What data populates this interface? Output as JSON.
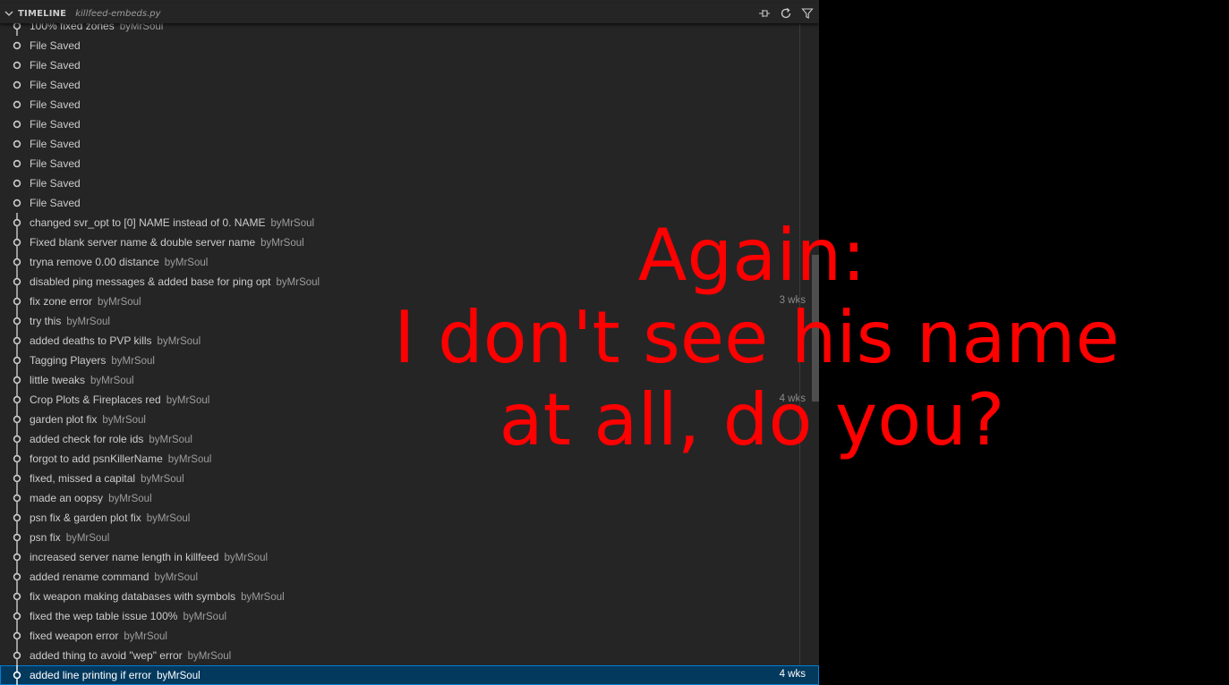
{
  "header": {
    "title": "TIMELINE",
    "file": "killfeed-embeds.py",
    "actions": [
      "pin-icon",
      "refresh-icon",
      "filter-icon"
    ]
  },
  "entries": [
    {
      "label": "100% fixed zones",
      "author": "byMrSoul",
      "time": "",
      "kind": "commit"
    },
    {
      "label": "File Saved",
      "author": "",
      "time": "",
      "kind": "save"
    },
    {
      "label": "File Saved",
      "author": "",
      "time": "",
      "kind": "save"
    },
    {
      "label": "File Saved",
      "author": "",
      "time": "",
      "kind": "save"
    },
    {
      "label": "File Saved",
      "author": "",
      "time": "",
      "kind": "save"
    },
    {
      "label": "File Saved",
      "author": "",
      "time": "",
      "kind": "save"
    },
    {
      "label": "File Saved",
      "author": "",
      "time": "",
      "kind": "save"
    },
    {
      "label": "File Saved",
      "author": "",
      "time": "",
      "kind": "save"
    },
    {
      "label": "File Saved",
      "author": "",
      "time": "",
      "kind": "save"
    },
    {
      "label": "File Saved",
      "author": "",
      "time": "",
      "kind": "save"
    },
    {
      "label": "changed svr_opt to [0] NAME instead of 0. NAME",
      "author": "byMrSoul",
      "time": "",
      "kind": "commit"
    },
    {
      "label": "Fixed blank server name & double server name",
      "author": "byMrSoul",
      "time": "",
      "kind": "commit"
    },
    {
      "label": "tryna remove 0.00 distance",
      "author": "byMrSoul",
      "time": "",
      "kind": "commit"
    },
    {
      "label": "disabled ping messages & added base for ping opt",
      "author": "byMrSoul",
      "time": "",
      "kind": "commit"
    },
    {
      "label": "fix zone error",
      "author": "byMrSoul",
      "time": "3 wks",
      "kind": "commit"
    },
    {
      "label": "try this",
      "author": "byMrSoul",
      "time": "",
      "kind": "commit"
    },
    {
      "label": "added deaths to PVP kills",
      "author": "byMrSoul",
      "time": "",
      "kind": "commit"
    },
    {
      "label": "Tagging Players",
      "author": "byMrSoul",
      "time": "",
      "kind": "commit"
    },
    {
      "label": "little tweaks",
      "author": "byMrSoul",
      "time": "",
      "kind": "commit"
    },
    {
      "label": "Crop Plots & Fireplaces red",
      "author": "byMrSoul",
      "time": "4 wks",
      "kind": "commit"
    },
    {
      "label": "garden plot fix",
      "author": "byMrSoul",
      "time": "",
      "kind": "commit"
    },
    {
      "label": "added check for role ids",
      "author": "byMrSoul",
      "time": "",
      "kind": "commit"
    },
    {
      "label": "forgot to add psnKillerName",
      "author": "byMrSoul",
      "time": "",
      "kind": "commit"
    },
    {
      "label": "fixed, missed a capital",
      "author": "byMrSoul",
      "time": "",
      "kind": "commit"
    },
    {
      "label": "made an oopsy",
      "author": "byMrSoul",
      "time": "",
      "kind": "commit"
    },
    {
      "label": "psn fix & garden plot fix",
      "author": "byMrSoul",
      "time": "",
      "kind": "commit"
    },
    {
      "label": "psn fix",
      "author": "byMrSoul",
      "time": "",
      "kind": "commit"
    },
    {
      "label": "increased server name length in killfeed",
      "author": "byMrSoul",
      "time": "",
      "kind": "commit"
    },
    {
      "label": "added rename command",
      "author": "byMrSoul",
      "time": "",
      "kind": "commit"
    },
    {
      "label": "fix weapon making databases with symbols",
      "author": "byMrSoul",
      "time": "",
      "kind": "commit"
    },
    {
      "label": "fixed the wep table issue 100%",
      "author": "byMrSoul",
      "time": "",
      "kind": "commit"
    },
    {
      "label": "fixed weapon error",
      "author": "byMrSoul",
      "time": "",
      "kind": "commit"
    },
    {
      "label": "added thing to avoid \"wep\" error",
      "author": "byMrSoul",
      "time": "",
      "kind": "commit"
    },
    {
      "label": "added line printing if error",
      "author": "byMrSoul",
      "time": "4 wks",
      "kind": "commit",
      "selected": true
    }
  ],
  "overlay": {
    "lines": [
      "Again:",
      "I don't see his name",
      "at all, do you?"
    ],
    "color": "#ff0000"
  },
  "colors": {
    "panel_bg": "#252526",
    "text": "#cccccc",
    "description": "#9d9d9d",
    "selected_bg": "#04395e",
    "selected_border": "#007fd4"
  }
}
